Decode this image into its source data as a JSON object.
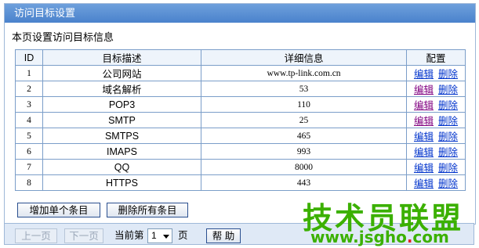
{
  "panel": {
    "title": "访问目标设置",
    "subtitle": "本页设置访问目标信息"
  },
  "table": {
    "headers": [
      "ID",
      "目标描述",
      "详细信息",
      "配置"
    ],
    "rows": [
      {
        "id": "1",
        "desc": "公司网站",
        "detail": "www.tp-link.com.cn"
      },
      {
        "id": "2",
        "desc": "域名解析",
        "detail": "53"
      },
      {
        "id": "3",
        "desc": "POP3",
        "detail": "110"
      },
      {
        "id": "4",
        "desc": "SMTP",
        "detail": "25"
      },
      {
        "id": "5",
        "desc": "SMTPS",
        "detail": "465"
      },
      {
        "id": "6",
        "desc": "IMAPS",
        "detail": "993"
      },
      {
        "id": "7",
        "desc": "QQ",
        "detail": "8000"
      },
      {
        "id": "8",
        "desc": "HTTPS",
        "detail": "443"
      }
    ],
    "edit_label": "编辑",
    "delete_label": "删除"
  },
  "actions": {
    "add_label": "增加单个条目",
    "delete_all_label": "删除所有条目"
  },
  "pager": {
    "prev_label": "上一页",
    "next_label": "下一页",
    "current_prefix": "当前第",
    "current_page": "1",
    "current_suffix": "页",
    "help_label": "帮 助"
  },
  "watermark": {
    "text": "技术员联盟",
    "url_prefix": "www.jsgho",
    "url_dot": ".",
    "url_suffix": "com"
  }
}
